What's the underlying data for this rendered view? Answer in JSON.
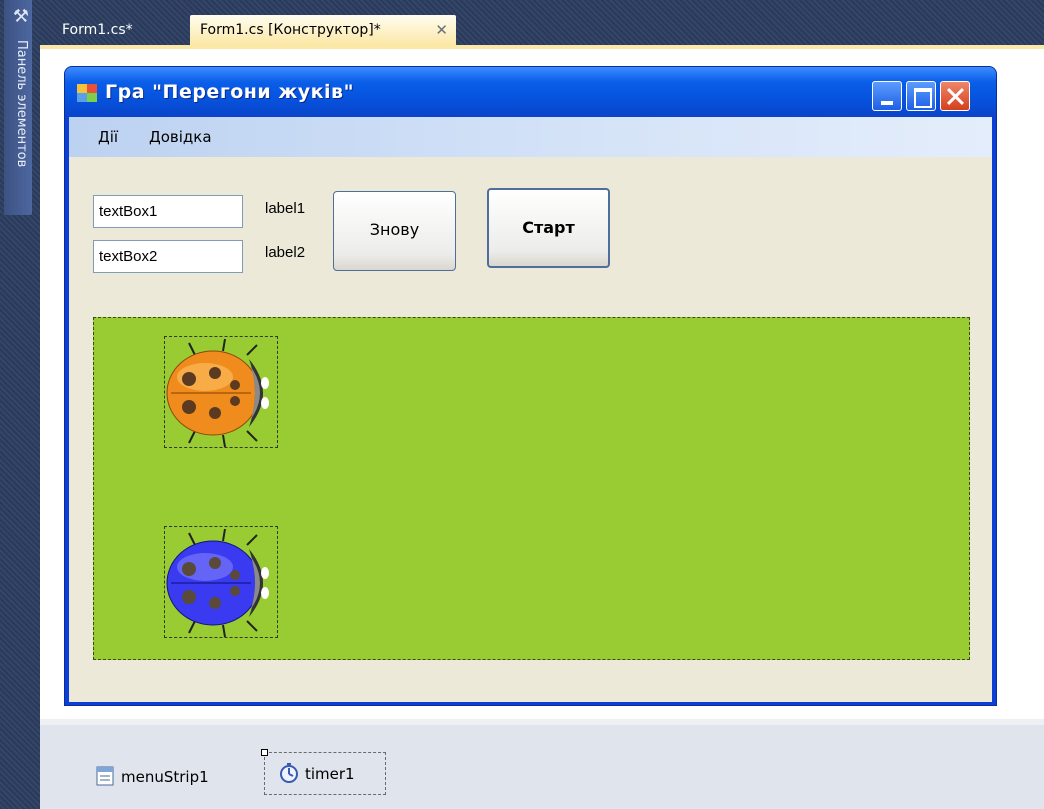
{
  "toolbox": {
    "label": "Панель элементов",
    "icon": "toolbox-icon"
  },
  "tabs": [
    {
      "label": "Form1.cs*",
      "active": false
    },
    {
      "label": "Form1.cs [Конструктор]*",
      "active": true,
      "close": "✕"
    }
  ],
  "form": {
    "title": "Гра \"Перегони жуків\"",
    "menu": [
      {
        "label": "Дії"
      },
      {
        "label": "Довідка"
      }
    ],
    "textbox1": "textBox1",
    "textbox2": "textBox2",
    "label1": "label1",
    "label2": "label2",
    "button_again": "Знову",
    "button_start": "Старт",
    "race_panel_color": "#99cc33",
    "bugs": [
      {
        "name": "orange-ladybug",
        "color": "#f08c1e"
      },
      {
        "name": "blue-ladybug",
        "color": "#3a3af0"
      }
    ]
  },
  "tray": {
    "items": [
      {
        "label": "menuStrip1",
        "icon": "menustrip-icon"
      },
      {
        "label": "timer1",
        "icon": "timer-icon",
        "selected": true
      }
    ]
  }
}
